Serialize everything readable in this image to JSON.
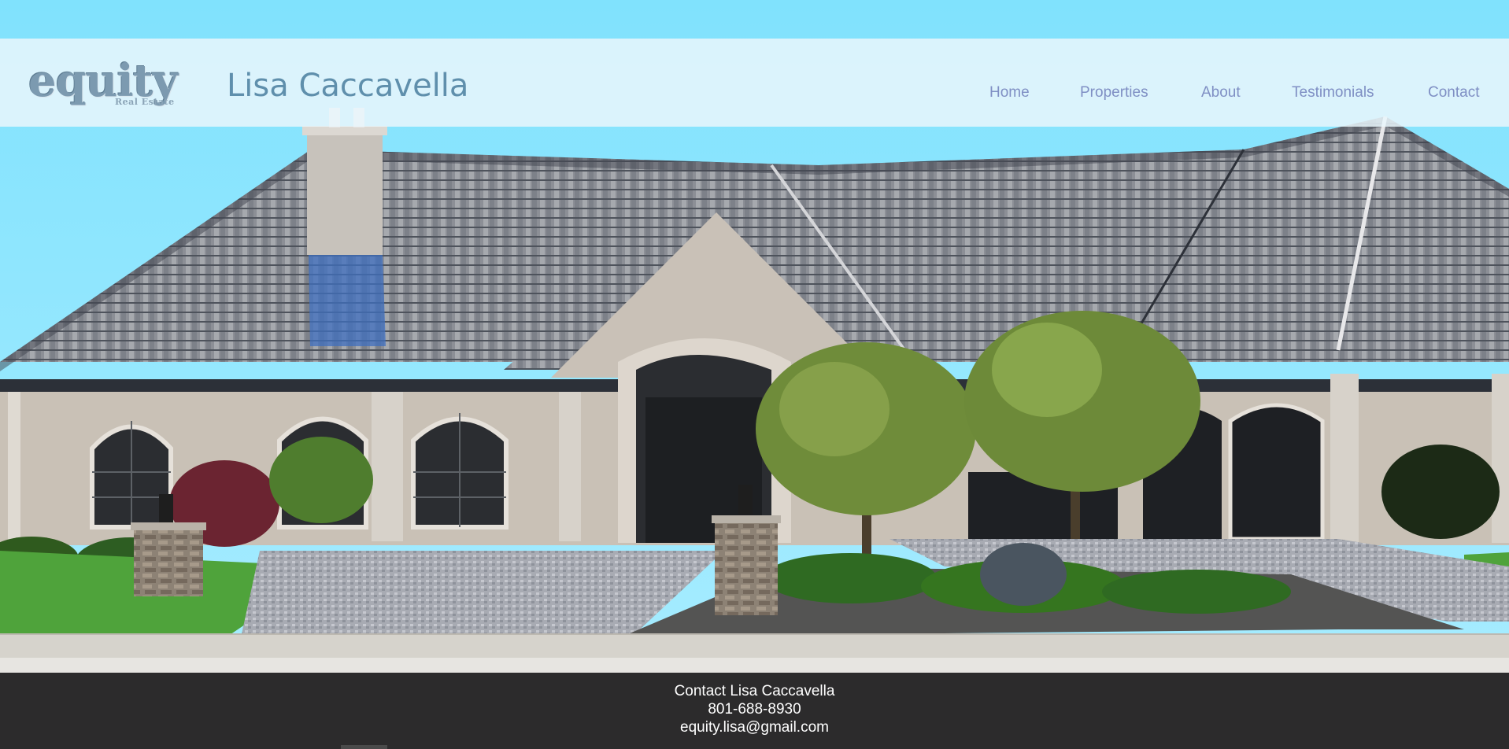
{
  "header": {
    "logo_brand": "equity",
    "logo_subtext": "Real Estate",
    "agent_name": "Lisa Caccavella"
  },
  "nav": {
    "items": [
      {
        "label": "Home"
      },
      {
        "label": "Properties"
      },
      {
        "label": "About"
      },
      {
        "label": "Testimonials"
      },
      {
        "label": "Contact"
      }
    ]
  },
  "hero": {
    "icon": "house-photo-icon"
  },
  "footer": {
    "title": "Contact Lisa Caccavella",
    "phone": "801-688-8930",
    "email": "equity.lisa@gmail.com"
  },
  "colors": {
    "sky": "#86e3fb",
    "header_bg": "#e9f6fc",
    "nav_text": "#7f8fc4",
    "logo_text": "#5f8fac",
    "footer_bg": "#2c2b2c"
  }
}
